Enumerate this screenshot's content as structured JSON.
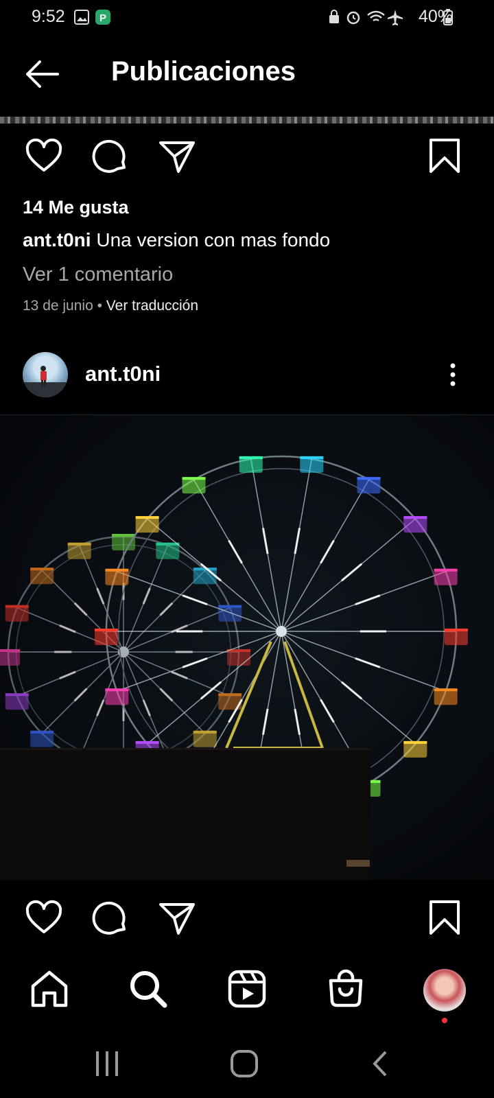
{
  "status_bar": {
    "time": "9:52",
    "battery": "40%",
    "icons": [
      "gallery-icon",
      "app-icon",
      "lock-icon",
      "alarm-icon",
      "wifi-icon",
      "airplane-icon",
      "battery-icon"
    ]
  },
  "header": {
    "title": "Publicaciones",
    "back_icon": "arrow-left-icon"
  },
  "post1": {
    "likes": "14 Me gusta",
    "caption_user": "ant.t0ni",
    "caption_text": " Una version con mas fondo",
    "comments_link": "Ver 1 comentario",
    "date": "13 de junio",
    "separator": " • ",
    "translate_link": "Ver traducción"
  },
  "post2": {
    "username": "ant.t0ni",
    "image_subject": "ferris-wheel-night-lights"
  },
  "actions": [
    "heart-icon",
    "comment-icon",
    "share-icon",
    "bookmark-icon"
  ],
  "bottom_nav": [
    "home-icon",
    "search-icon",
    "reels-icon",
    "shop-icon",
    "profile-avatar"
  ],
  "system_nav": [
    "recents-icon",
    "home-circle-icon",
    "back-chevron-icon"
  ],
  "colors": {
    "background": "#000000",
    "secondary_text": "#a8a8a8",
    "notification_dot": "#ff3040"
  }
}
